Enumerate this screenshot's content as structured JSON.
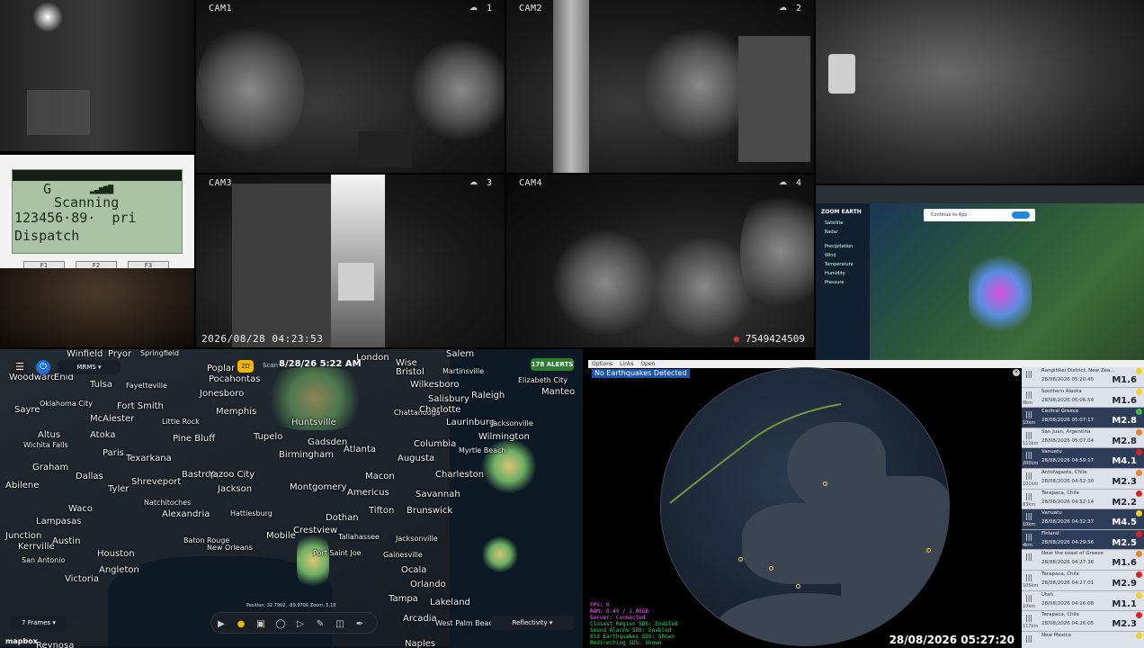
{
  "cameras": [
    {
      "label": "CAM1",
      "num": "1"
    },
    {
      "label": "CAM2",
      "num": "2"
    },
    {
      "label": "CAM3",
      "num": "3"
    },
    {
      "label": "CAM4",
      "num": "4"
    }
  ],
  "nvr": {
    "timestamp": "2026/08/28 04:23:53",
    "device_id": "7549424509"
  },
  "scanner": {
    "line1": "G",
    "line2": "Scanning",
    "line3": "123456·89·  pri",
    "line4": "Dispatch",
    "buttons": [
      "F1",
      "F2",
      "F3"
    ]
  },
  "zoom_earth": {
    "logo": "ZOOM EARTH",
    "banner": "Continue to App",
    "menu": [
      "Satellite",
      "Radar",
      "Precipitation",
      "Wind",
      "Temperature",
      "Humidity",
      "Pressure"
    ]
  },
  "nws_map": {
    "layer": "MRMS",
    "scan_label": "Scan",
    "scan_time": "8/28/26 5:22 AM",
    "alerts": "178 ALERTS",
    "frames": "7 Frames",
    "product": "Reflectivity",
    "position": "Position: 32.7902, -89.9700  Zoom: 5.18",
    "attribution": "mapbox",
    "cities": [
      "Winfield",
      "Pryor",
      "Springfield",
      "Poplar",
      "London",
      "Wise",
      "Salem",
      "Woodward",
      "Enid",
      "Bristol",
      "Martinsville",
      "Tulsa",
      "Fayetteville",
      "Pocahontas",
      "Jonesboro",
      "Wilkesboro",
      "Elizabeth City",
      "Manteo",
      "Oklahoma City",
      "Fort Smith",
      "Memphis",
      "Salisbury",
      "Raleigh",
      "Sayre",
      "McAlester",
      "Little Rock",
      "Huntsville",
      "Chattanooga",
      "Charlotte",
      "Laurinburg",
      "Jacksonville",
      "Altus",
      "Atoka",
      "Pine Bluff",
      "Tupelo",
      "Gadsden",
      "Atlanta",
      "Columbia",
      "Wilmington",
      "Wichita Falls",
      "Paris",
      "Texarkana",
      "Birmingham",
      "Augusta",
      "Myrtle Beach",
      "Graham",
      "Dallas",
      "Bastrop",
      "Yazoo City",
      "Macon",
      "Charleston",
      "Abilene",
      "Shreveport",
      "Jackson",
      "Montgomery",
      "Americus",
      "Savannah",
      "Waco",
      "Tyler",
      "Natchitoches",
      "Dothan",
      "Tifton",
      "Brunswick",
      "Lampasas",
      "Alexandria",
      "Hattiesburg",
      "Junction",
      "Austin",
      "Baton Rouge",
      "Mobile",
      "Crestview",
      "Tallahassee",
      "Jacksonville",
      "Kerrville",
      "New Orleans",
      "Port Saint Joe",
      "Gainesville",
      "San Antonio",
      "Houston",
      "Ocala",
      "Orlando",
      "Victoria",
      "Angleton",
      "Tampa",
      "Lakeland",
      "Arcadia",
      "West Palm Beach",
      "Naples",
      "Reynosa"
    ]
  },
  "earthquakes": {
    "menu": [
      "Options",
      "Links",
      "Open"
    ],
    "banner": "No Earthquakes Detected",
    "clock": "28/08/2026 05:27:20",
    "status": [
      {
        "text": "FPS: 0",
        "color": "#ff5bff"
      },
      {
        "text": "RAM: 0.49 / 1.00GB",
        "color": "#ff5bff"
      },
      {
        "text": "Server: Connected",
        "color": "#ff5bff"
      },
      {
        "text": "Closest Region SDS: Enabled",
        "color": "#33dd55"
      },
      {
        "text": "Sound Alarms SDS: Enabled",
        "color": "#33dd55"
      },
      {
        "text": "Old Earthquakes SDS: Shown",
        "color": "#33dd55"
      },
      {
        "text": "Redirecting SDS: Shown",
        "color": "#33dd55"
      }
    ],
    "items": [
      {
        "loc": "Rangitikei District, New Zea...",
        "dt": "28/08/2026 05:20:45",
        "mag": "M1.6",
        "depth": "",
        "dark": false,
        "alert": "#f5d020"
      },
      {
        "loc": "Southern Alaska",
        "dt": "28/08/2026 05:06:54",
        "mag": "M1.6",
        "depth": "0km",
        "dark": false,
        "alert": "#f5d020"
      },
      {
        "loc": "Central Greece",
        "dt": "28/08/2026 05:07:17",
        "mag": "M2.8",
        "depth": "10km",
        "dark": true,
        "alert": "#40c040"
      },
      {
        "loc": "San Juan, Argentina",
        "dt": "28/08/2026 05:07:04",
        "mag": "M2.8",
        "depth": "111km",
        "dark": false,
        "alert": "#f08020"
      },
      {
        "loc": "Vanuatu",
        "dt": "28/08/2026 04:59:17",
        "mag": "M4.1",
        "depth": "200km",
        "dark": true,
        "alert": "#e02020"
      },
      {
        "loc": "Antofagasta, Chile",
        "dt": "28/08/2026 04:52:30",
        "mag": "M2.3",
        "depth": "101km",
        "dark": false,
        "alert": "#f08020"
      },
      {
        "loc": "Tarapaca, Chile",
        "dt": "28/08/2026 04:52:14",
        "mag": "M2.2",
        "depth": "83km",
        "dark": false,
        "alert": "#e02020"
      },
      {
        "loc": "Vanuatu",
        "dt": "28/08/2026 04:32:37",
        "mag": "M4.5",
        "depth": "10km",
        "dark": true,
        "alert": "#f5d020"
      },
      {
        "loc": "Finland",
        "dt": "28/08/2026 04:29:56",
        "mag": "M2.5",
        "depth": "4km",
        "dark": true,
        "alert": "#e02020"
      },
      {
        "loc": "Near the coast of Greece",
        "dt": "28/08/2026 04:27:36",
        "mag": "M1.6",
        "depth": "",
        "dark": false,
        "alert": "#f08020"
      },
      {
        "loc": "Tarapaca, Chile",
        "dt": "28/08/2026 04:27:01",
        "mag": "M2.9",
        "depth": "105km",
        "dark": false,
        "alert": "#e02020"
      },
      {
        "loc": "Utah",
        "dt": "28/08/2026 04:26:08",
        "mag": "M1.1",
        "depth": "10km",
        "dark": false,
        "alert": "#f5d020"
      },
      {
        "loc": "Tarapaca, Chile",
        "dt": "28/08/2026 04:26:05",
        "mag": "M2.3",
        "depth": "117km",
        "dark": false,
        "alert": "#e02020"
      },
      {
        "loc": "New Mexico",
        "dt": "",
        "mag": "",
        "depth": "",
        "dark": false,
        "alert": "#f5d020"
      }
    ]
  }
}
